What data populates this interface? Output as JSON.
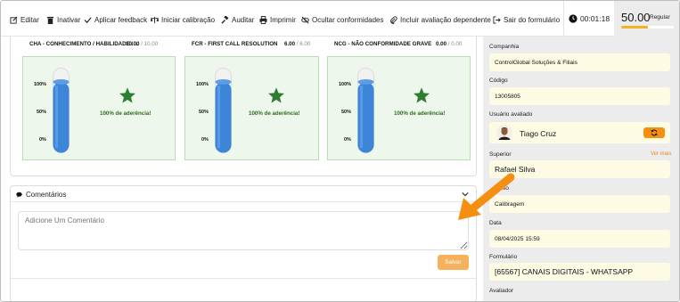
{
  "toolbar": {
    "items": [
      {
        "label": "Editar",
        "icon": "edit-icon"
      },
      {
        "label": "Inativar",
        "icon": "trash-icon"
      },
      {
        "label": "Aplicar feedback",
        "icon": "check-icon"
      },
      {
        "label": "Iniciar calibração",
        "icon": "scale-icon"
      },
      {
        "label": "Auditar",
        "icon": "gavel-icon"
      },
      {
        "label": "Imprimir",
        "icon": "print-icon"
      },
      {
        "label": "Ocultar conformidades",
        "icon": "eye-slash-icon"
      },
      {
        "label": "Incluir avaliação dependente",
        "icon": "paperclip-icon"
      },
      {
        "label": "Sair do formulário",
        "icon": "logout-icon"
      }
    ],
    "timer": "00:01:18",
    "score": "50.00",
    "score_label": "Regular",
    "score_progress": 0.5
  },
  "cards": [
    {
      "title": "CHA - CONHECIMENTO / HABILIDADE / ...",
      "score": "10.00",
      "max": "/ 10.00",
      "ticks": [
        "100%",
        "50%",
        "0%"
      ],
      "adherence": "100% de aderência!"
    },
    {
      "title": "FCR - FIRST CALL RESOLUTION",
      "score": "6.00",
      "max": "/ 6.00",
      "ticks": [
        "100%",
        "50%",
        "0%"
      ],
      "adherence": "100% de aderência!"
    },
    {
      "title": "NCG - NÃO CONFORMIDADE GRAVE",
      "score": "0.00",
      "max": "/ 0.00",
      "ticks": [
        "100%",
        "50%",
        "0%"
      ],
      "adherence": "100% de aderência!"
    }
  ],
  "comments": {
    "title": "Comentários",
    "placeholder": "Adicione Um Comentário",
    "save_label": "Salvar"
  },
  "panel": {
    "company_label": "Companhia",
    "company_value": "ControlGlobal Soluções & Filiais",
    "code_label": "Código",
    "code_value": "13005805",
    "user_label": "Usuário avaliado",
    "user_name": "Tiago Cruz",
    "superior_label": "Superior",
    "ver_mais": "Ver mais",
    "superior_value": "Rafael Silva",
    "process_label_partial": "so",
    "process_value": "Calibragem",
    "date_label": "Data",
    "date_value": "08/04/2025 15:59",
    "form_label": "Formulário",
    "form_value": "[65567] CANAIS DIGITAIS - WHATSAPP",
    "evaluator_label": "Avaliador"
  },
  "colors": {
    "accent_orange": "#f58f12",
    "tube_blue": "#3d85d8",
    "star_green": "#2e7d32",
    "field_bg": "#fdfbe3",
    "score_bar": "#f0b323"
  }
}
